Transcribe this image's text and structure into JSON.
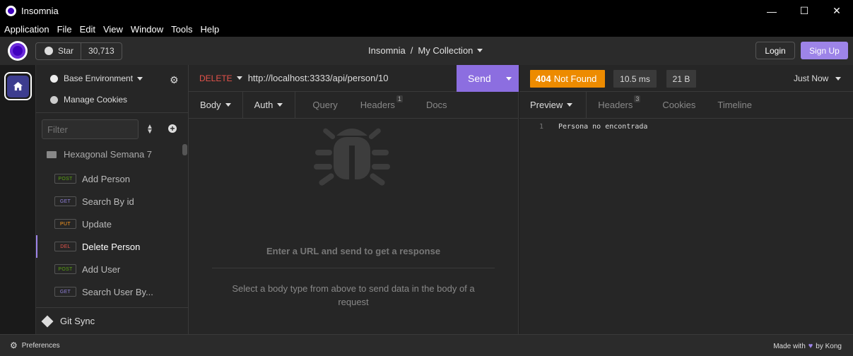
{
  "window": {
    "title": "Insomnia",
    "minimize": "—",
    "maximize": "☐",
    "close": "✕"
  },
  "menu": [
    "Application",
    "File",
    "Edit",
    "View",
    "Window",
    "Tools",
    "Help"
  ],
  "header": {
    "star_label": "Star",
    "star_count": "30,713",
    "breadcrumb_root": "Insomnia",
    "breadcrumb_sep": "/",
    "breadcrumb_current": "My Collection",
    "login_label": "Login",
    "signup_label": "Sign Up"
  },
  "sidebar": {
    "environment": "Base Environment",
    "manage_cookies": "Manage Cookies",
    "filter_placeholder": "Filter",
    "folder": "Hexagonal Semana 7",
    "requests": [
      {
        "method": "POST",
        "name": "Add Person",
        "color": "#59a210"
      },
      {
        "method": "GET",
        "name": "Search By id",
        "color": "#8f7fd9"
      },
      {
        "method": "PUT",
        "name": "Update",
        "color": "#ff9a1f"
      },
      {
        "method": "DEL",
        "name": "Delete Person",
        "color": "#e5534b",
        "active": true
      },
      {
        "method": "POST",
        "name": "Add User",
        "color": "#59a210"
      },
      {
        "method": "GET",
        "name": "Search User By...",
        "color": "#8f7fd9"
      }
    ],
    "git_sync": "Git Sync"
  },
  "request": {
    "method": "DELETE",
    "url": "http://localhost:3333/api/person/10",
    "send_label": "Send",
    "tabs": [
      {
        "label": "Body",
        "active": true
      },
      {
        "label": "Auth",
        "active": true
      },
      {
        "label": "Query"
      },
      {
        "label": "Headers",
        "badge": "1"
      },
      {
        "label": "Docs"
      }
    ],
    "empty_title": "Enter a URL and send to get a response",
    "empty_sub": "Select a body type from above to send data in the body of a request"
  },
  "response": {
    "status_code": "404",
    "status_text": "Not Found",
    "time": "10.5 ms",
    "size": "21 B",
    "when": "Just Now",
    "tabs": [
      {
        "label": "Preview",
        "active": true
      },
      {
        "label": "Headers",
        "badge": "3"
      },
      {
        "label": "Cookies"
      },
      {
        "label": "Timeline"
      }
    ],
    "line_number": "1",
    "body": "Persona no encontrada"
  },
  "statusbar": {
    "preferences": "Preferences",
    "made_with": "Made with",
    "by": "by Kong"
  }
}
